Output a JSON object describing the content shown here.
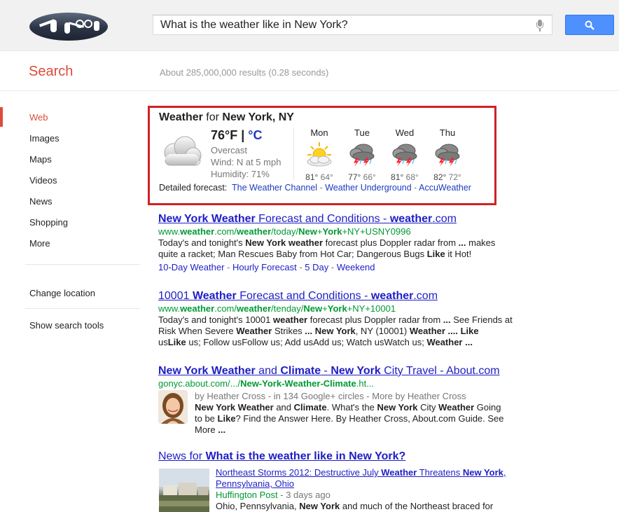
{
  "search": {
    "query": "What is the weather like in New York?",
    "title": "Search",
    "stats": "About 285,000,000 results (0.28 seconds)"
  },
  "nav": {
    "items": [
      {
        "label": "Web",
        "active": true
      },
      {
        "label": "Images"
      },
      {
        "label": "Maps"
      },
      {
        "label": "Videos"
      },
      {
        "label": "News"
      },
      {
        "label": "Shopping"
      },
      {
        "label": "More"
      }
    ],
    "change_location": "Change location",
    "show_tools": "Show search tools"
  },
  "weather": {
    "title_prefix": "Weather",
    "title_for": " for ",
    "location": "New York, NY",
    "temp_f": "76°F",
    "temp_sep": " | ",
    "temp_c": "°C",
    "condition": "Overcast",
    "wind": "Wind: N at 5 mph",
    "humidity": "Humidity: 71%",
    "current_icon": "cloud-icon",
    "forecast": [
      {
        "day": "Mon",
        "hi": "81°",
        "lo": "64°",
        "icon": "partly-sunny-icon"
      },
      {
        "day": "Tue",
        "hi": "77°",
        "lo": "66°",
        "icon": "thunderstorm-icon"
      },
      {
        "day": "Wed",
        "hi": "81°",
        "lo": "68°",
        "icon": "thunderstorm-icon"
      },
      {
        "day": "Thu",
        "hi": "82°",
        "lo": "72°",
        "icon": "thunderstorm-icon"
      }
    ],
    "detailed_label": "Detailed forecast:",
    "sources": [
      "The Weather Channel",
      "Weather Underground",
      "AccuWeather"
    ],
    "border_color": "#d02226"
  },
  "results": [
    {
      "title_parts": [
        "New York Weather",
        " Forecast and Conditions - ",
        "weather",
        ".com"
      ],
      "url_parts": [
        "www.",
        "weather",
        ".com/",
        "weather",
        "/today/",
        "New",
        "+",
        "York",
        "+NY+USNY0996"
      ],
      "snippet_lines": [
        [
          "Today's and tonight's ",
          "New York weather",
          " forecast plus Doppler radar from ",
          "...",
          " makes"
        ],
        [
          "quite a racket; Man Rescues Baby from Hot Car; Dangerous Bugs ",
          "Like",
          " it Hot!"
        ]
      ],
      "sitelinks": [
        "10-Day Weather",
        "Hourly Forecast",
        "5 Day",
        "Weekend"
      ]
    },
    {
      "title_parts": [
        "10001 ",
        "Weather",
        " Forecast and Conditions - ",
        "weather",
        ".com"
      ],
      "url_parts": [
        "www.",
        "weather",
        ".com/",
        "weather",
        "/tenday/",
        "New",
        "+",
        "York",
        "+NY+10001"
      ],
      "snippet_lines": [
        [
          "Today's and tonight's 10001 ",
          "weather",
          " forecast plus Doppler radar from ",
          "...",
          " See Friends at"
        ],
        [
          "Risk When Severe ",
          "Weather",
          " Strikes ",
          "... New York",
          ", NY (10001) ",
          "Weather .... Like"
        ],
        [
          "us",
          "Like",
          " us; Follow usFollow us; Add usAdd us; Watch usWatch us; ",
          "Weather ..."
        ]
      ]
    },
    {
      "title_parts": [
        "New York Weather",
        " and ",
        "Climate",
        " - ",
        "New York",
        " City Travel - About.com"
      ],
      "url_parts": [
        "gonyc.about.com/.../",
        "New-York-Weather-Climate",
        ".ht..."
      ],
      "author": "by Heather Cross - in 134 Google+ circles - More by Heather Cross",
      "snippet_lines": [
        [
          "New York Weather",
          " and ",
          "Climate",
          ". What's the ",
          "New York",
          " City ",
          "Weather",
          " Going"
        ],
        [
          "to be ",
          "Like",
          "? Find the Answer Here. By Heather Cross, About.com Guide. See"
        ],
        [
          "More ",
          "..."
        ]
      ]
    }
  ],
  "news": {
    "head_prefix": "News for ",
    "head_query": "What is the weather like in New York?",
    "title_line1_parts": [
      "Northeast Storms 2012: Destructive July ",
      "Weather",
      " Threatens ",
      "New York",
      ","
    ],
    "title_line2": "Pennsylvania, Ohio",
    "source": "Huffington Post",
    "ago": " - 3 days ago",
    "snippet_parts": [
      "Ohio, Pennsylvania, ",
      "New York",
      " and much of the Northeast braced for"
    ]
  }
}
